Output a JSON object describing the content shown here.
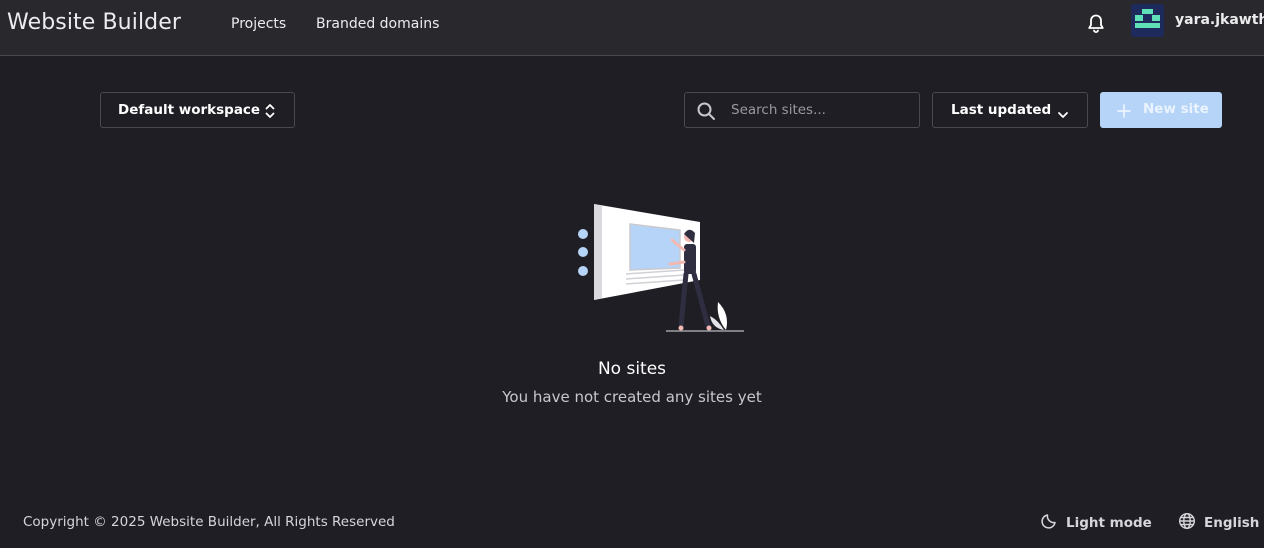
{
  "header": {
    "brand": "Website Builder",
    "nav": [
      {
        "label": "Projects"
      },
      {
        "label": "Branded domains"
      }
    ],
    "notifications_icon": "bell-icon",
    "avatar_icon": "identicon-avatar",
    "username": "yara.jkawtha"
  },
  "toolbar": {
    "workspace_label": "Default workspace",
    "search_placeholder": "Search sites...",
    "search_value": "",
    "sort_label": "Last updated",
    "new_site_label": "New site"
  },
  "empty_state": {
    "title": "No sites",
    "subtitle": "You have not created any sites yet"
  },
  "footer": {
    "copyright": "Copyright © 2025 Website Builder, All Rights Reserved",
    "theme_label": "Light mode",
    "language_label": "English"
  },
  "colors": {
    "background": "#1f1e24",
    "header_bg": "#29282d",
    "accent": "#b5d4f7",
    "border": "#4a494f"
  }
}
